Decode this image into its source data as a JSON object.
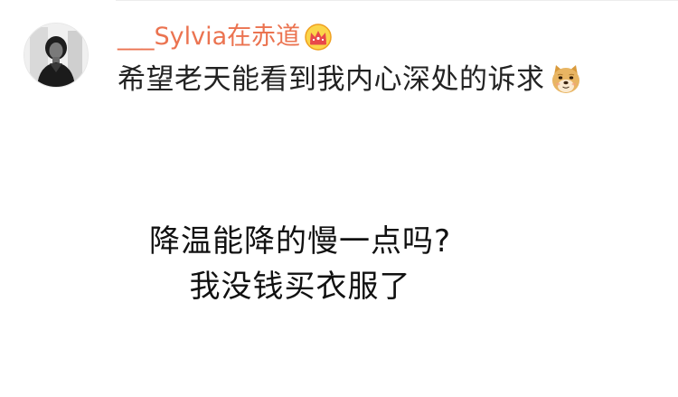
{
  "comment": {
    "author": {
      "name": "___Sylvia在赤道",
      "badge_icon": "crown-badge-icon",
      "name_color": "#eb7350"
    },
    "text": "希望老天能看到我内心深处的诉求",
    "emoji_icon": "doge-emoji-icon",
    "image": {
      "line1": "降温能降的慢一点吗?",
      "line2": "我没钱买衣服了"
    }
  }
}
